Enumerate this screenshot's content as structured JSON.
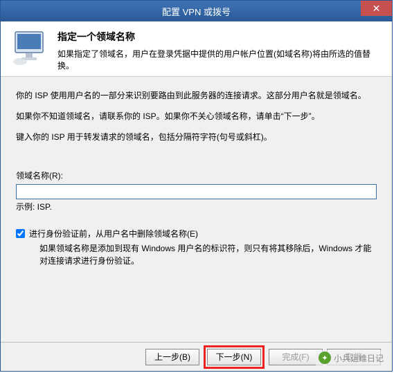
{
  "window": {
    "title": "配置 VPN 或拨号",
    "close": "✕"
  },
  "header": {
    "title": "指定一个领域名称",
    "desc": "如果指定了领域名，用户在登录凭据中提供的用户帐户位置(如域名称)将由所选的值替换。"
  },
  "body": {
    "para1": "你的 ISP 使用用户名的一部分来识别要路由到此服务器的连接请求。这部分用户名就是领域名。",
    "para2": "如果你不知道领域名，请联系你的 ISP。如果你不关心领域名称，请单击“下一步”。",
    "para3": "键入你的 ISP 用于转发请求的领域名，包括分隔符字符(句号或斜杠)。"
  },
  "field": {
    "label": "领域名称(R):",
    "value": "",
    "example": "示例: ISP."
  },
  "checkbox": {
    "checked": true,
    "label": "进行身份验证前，从用户名中删除领域名称(E)",
    "desc": "如果领域名称是添加到现有 Windows 用户名的标识符，则只有将其移除后，Windows 才能对连接请求进行身份验证。"
  },
  "buttons": {
    "back": "上一步(B)",
    "next": "下一步(N)",
    "finish": "完成(F)",
    "cancel": "取消"
  },
  "watermark": {
    "text": "小兵运维日记"
  }
}
